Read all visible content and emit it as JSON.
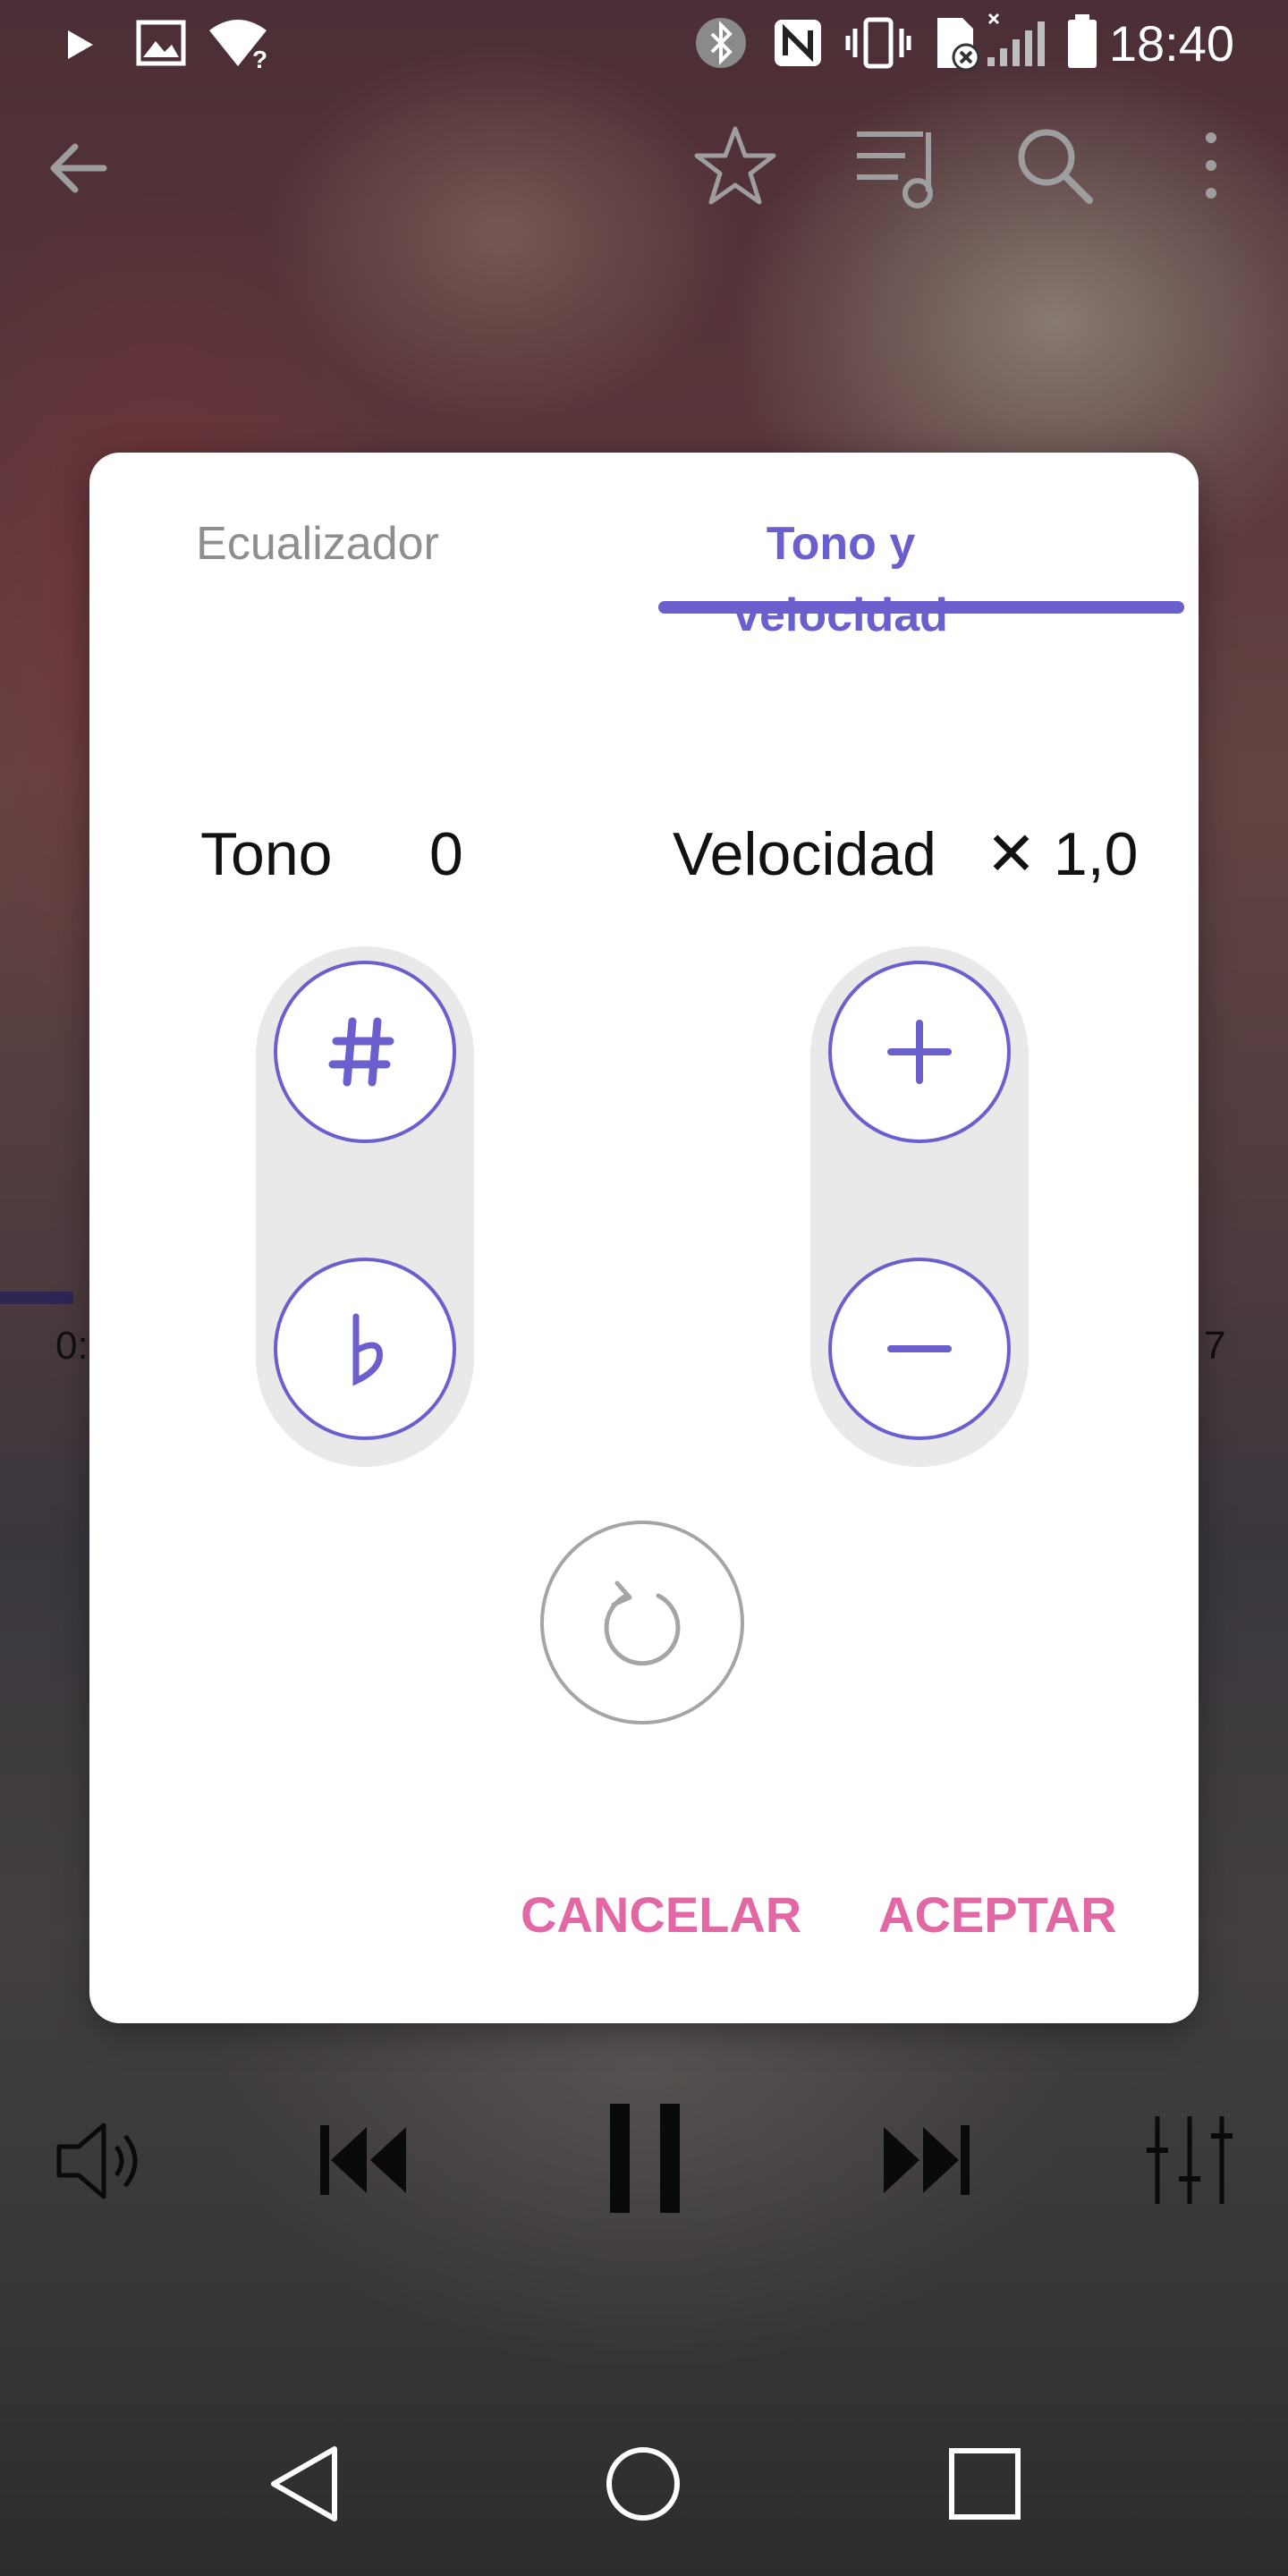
{
  "status_bar": {
    "time": "18:40",
    "icons": [
      "play-icon",
      "image-icon",
      "wifi-question-icon",
      "bluetooth-icon",
      "nfc-icon",
      "vibrate-icon",
      "sim-blocked-icon",
      "signal-icon",
      "battery-icon"
    ]
  },
  "player": {
    "time_elapsed": "0:",
    "time_total": "7"
  },
  "dialog": {
    "tabs": [
      {
        "label": "Ecualizador",
        "active": false
      },
      {
        "label": "Tono y velocidad",
        "active": true
      }
    ],
    "pitch": {
      "label": "Tono",
      "value": "0",
      "up_symbol": "#",
      "down_symbol": "♭"
    },
    "speed": {
      "label": "Velocidad",
      "value": "✕ 1,0",
      "up_symbol": "+",
      "down_symbol": "−"
    },
    "buttons": {
      "cancel": "CANCELAR",
      "accept": "ACEPTAR"
    }
  },
  "colors": {
    "accent": "#6a5fcd",
    "action": "#e168a4",
    "pill_bg": "#e9e9e9"
  }
}
